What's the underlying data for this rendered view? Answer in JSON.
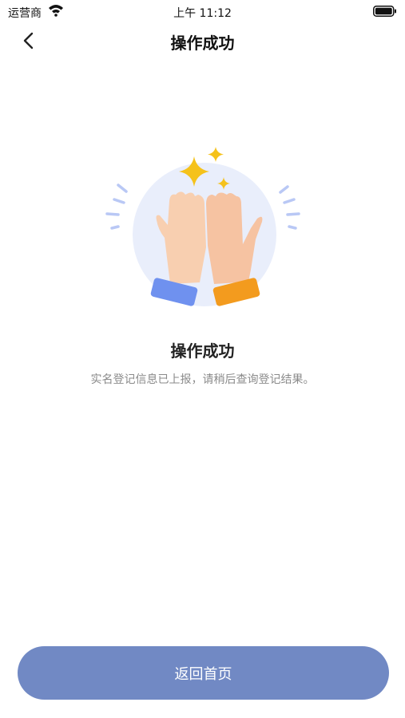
{
  "status_bar": {
    "carrier": "运营商",
    "time": "上午 11:12"
  },
  "nav": {
    "title": "操作成功",
    "back_icon": "chevron-left-icon"
  },
  "result": {
    "icon": "high-five-icon",
    "title": "操作成功",
    "description": "实名登记信息已上报，请稍后查询登记结果。"
  },
  "actions": {
    "home_label": "返回首页"
  },
  "colors": {
    "button_bg": "#7189c4",
    "sparkle": "#f5c21b",
    "circle_bg": "#e8eefc",
    "left_cuff": "#6f91ef",
    "right_cuff": "#f39b1e"
  }
}
